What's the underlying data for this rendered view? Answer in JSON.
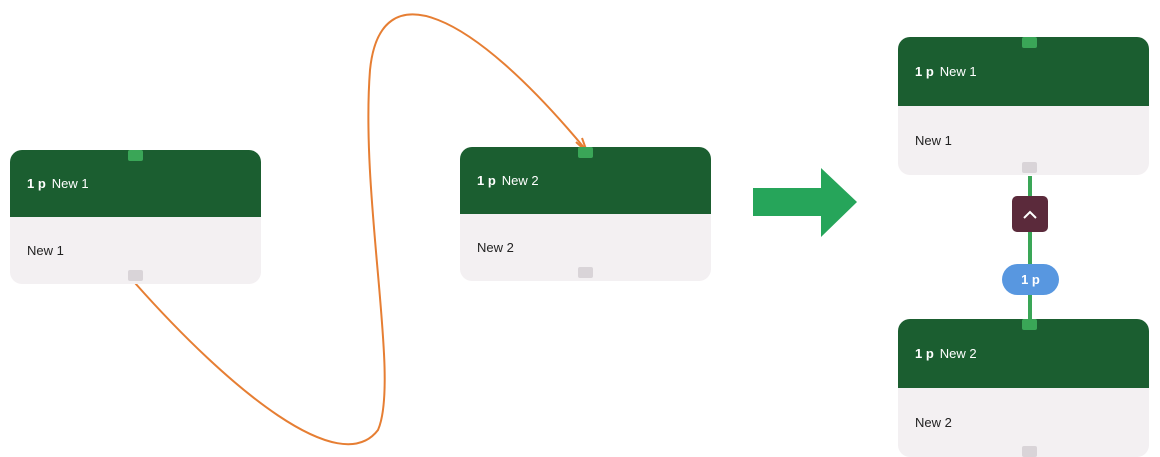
{
  "before": {
    "nodes": [
      {
        "count": "1 p",
        "title": "New 1",
        "body": "New 1"
      },
      {
        "count": "1 p",
        "title": "New 2",
        "body": "New 2"
      }
    ]
  },
  "after": {
    "nodes": [
      {
        "count": "1 p",
        "title": "New 1",
        "body": "New 1"
      },
      {
        "count": "1 p",
        "title": "New 2",
        "body": "New 2"
      }
    ],
    "edge_label": "1 p",
    "collapse_icon": "chevron-up-icon"
  },
  "colors": {
    "node_header": "#1b5e30",
    "node_body": "#f3f0f2",
    "input_port": "#3aa657",
    "output_port": "#d9d4d8",
    "drag_link": "#e67e33",
    "transition_arrow": "#26a55a",
    "connector": "#3aa657",
    "collapse_button": "#5b2a3b",
    "edge_badge": "#5897e0"
  }
}
